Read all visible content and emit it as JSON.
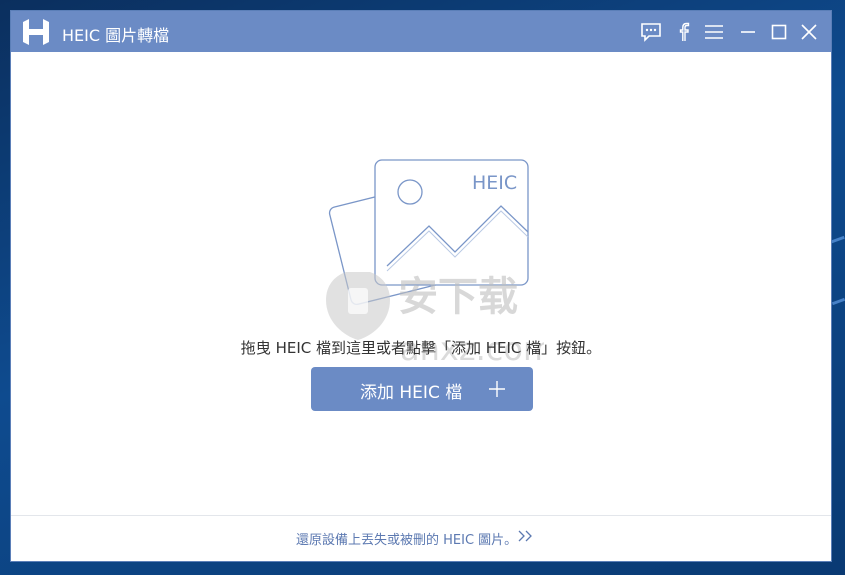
{
  "window": {
    "title": "HEIC 圖片轉檔"
  },
  "titlebar_icons": [
    "feedback-icon",
    "facebook-icon",
    "menu-icon",
    "minimize-icon",
    "maximize-icon",
    "close-icon"
  ],
  "illustration": {
    "badge": "HEIC"
  },
  "main": {
    "hint": "拖曳 HEIC 檔到這里或者點擊「添加 HEIC 檔」按鈕。",
    "add_button_label": "添加 HEIC 檔"
  },
  "footer": {
    "link": "還原設備上丟失或被刪的 HEIC 圖片。"
  },
  "watermark": {
    "text_top": "安下载",
    "text_bottom": "anxz.com"
  },
  "colors": {
    "accent": "#6b8bc5",
    "link": "#5c79b1",
    "text": "#333333",
    "desktop": "#0a3f7a"
  }
}
